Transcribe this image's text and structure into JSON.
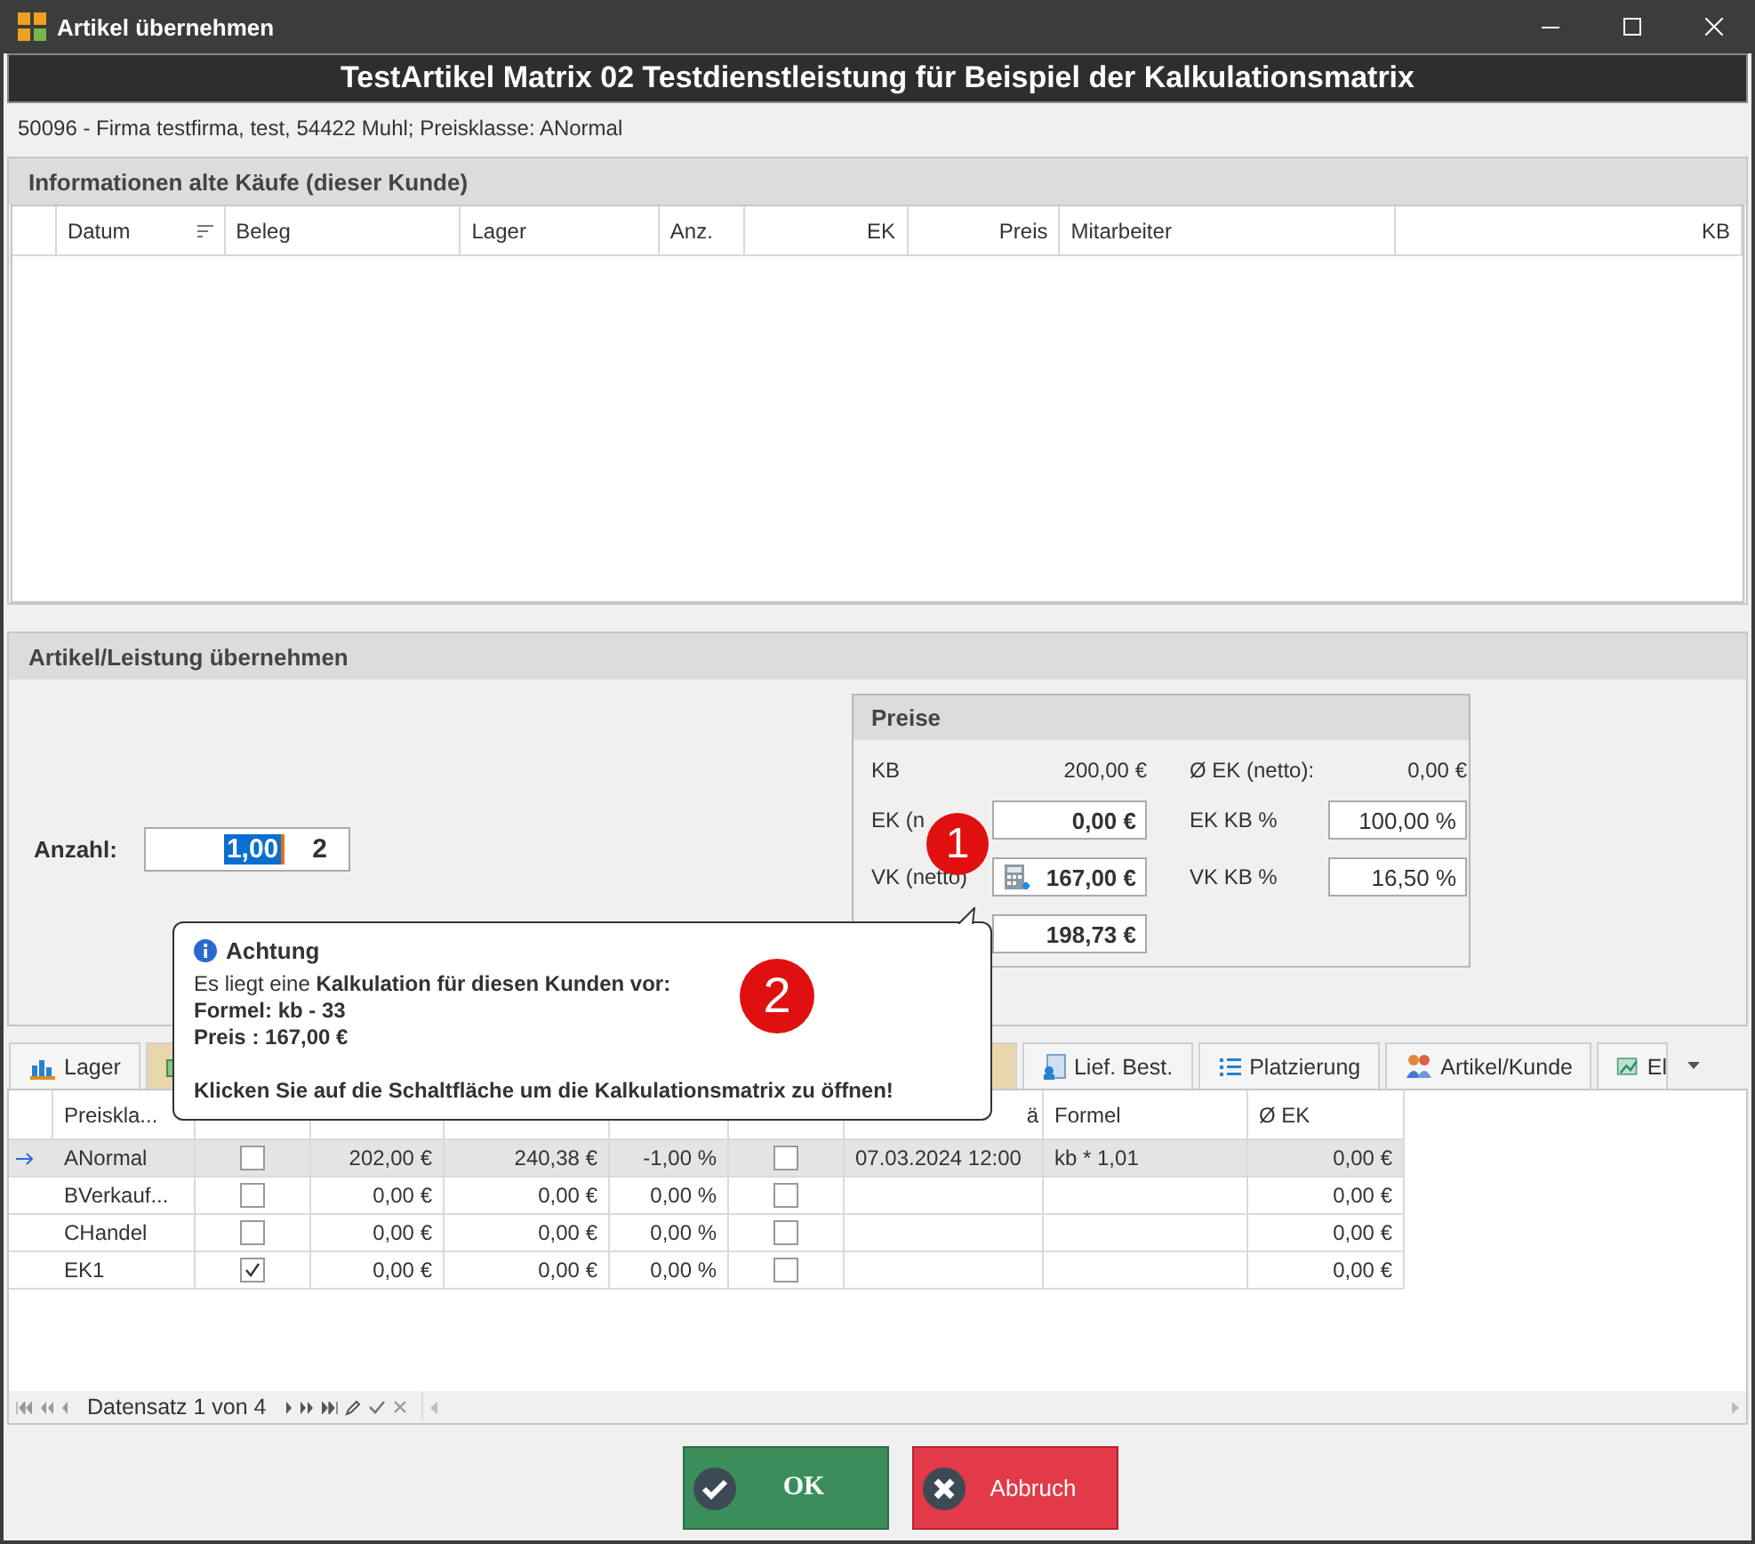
{
  "window": {
    "title": "Artikel übernehmen"
  },
  "header": {
    "title": "TestArtikel Matrix 02 Testdienstleistung für Beispiel der Kalkulationsmatrix"
  },
  "customer_line": "50096 - Firma testfirma, test, 54422 Muhl; Preisklasse: ANormal",
  "purchases": {
    "title": "Informationen alte Käufe (dieser Kunde)",
    "columns": [
      {
        "label": "Datum",
        "kind": "text",
        "sorted": true
      },
      {
        "label": "Beleg",
        "kind": "text",
        "sorted": false
      },
      {
        "label": "Lager",
        "kind": "text",
        "sorted": false
      },
      {
        "label": "Anz.",
        "kind": "text",
        "sorted": false
      },
      {
        "label": "EK",
        "kind": "number",
        "sorted": false
      },
      {
        "label": "Preis",
        "kind": "number",
        "sorted": false
      },
      {
        "label": "Mitarbeiter",
        "kind": "text",
        "sorted": false
      },
      {
        "label": "KB",
        "kind": "number",
        "sorted": false
      }
    ]
  },
  "transfer": {
    "title": "Artikel/Leistung übernehmen",
    "quantity": {
      "label": "Anzahl:",
      "value": "1,00",
      "suffix": "2"
    },
    "prices": {
      "title": "Preise",
      "kb_label": "KB",
      "kb_value": "200,00 €",
      "avg_ek_label": "Ø EK (netto):",
      "avg_ek_value": "0,00 €",
      "marker": "1",
      "left_fields": [
        {
          "label": "EK (n",
          "value": "0,00 €",
          "kind": "plain"
        },
        {
          "label": "VK (netto)",
          "value": "167,00 €",
          "kind": "calculator"
        },
        {
          "value": "198,73 €",
          "kind": "plain"
        }
      ],
      "right_fields": [
        {
          "label": "EK KB %",
          "value": "100,00 %"
        },
        {
          "label": "VK KB %",
          "value": "16,50 %"
        }
      ]
    }
  },
  "tooltip": {
    "title": "Achtung",
    "marker": "2",
    "paragraphs": [
      {
        "lines": [
          {
            "text": "Es liegt eine **Kalkulation für diesen Kunden vor:**",
            "bold": false
          },
          {
            "text": "Formel: kb - 33",
            "bold": true
          },
          {
            "text": "Preis : 167,00 €",
            "bold": true
          }
        ]
      },
      {
        "lines": [
          {
            "text": "Klicken Sie auf die Schaltfläche um die Kalkulationsmatrix zu öffnen!",
            "bold": true
          }
        ]
      }
    ]
  },
  "tabs": [
    {
      "label": "Lager",
      "selected": false
    },
    {
      "selected": true
    },
    {
      "label": "Lief. Best.",
      "selected": false
    },
    {
      "label": "Platzierung",
      "selected": false
    },
    {
      "label": "Artikel/Kunde",
      "selected": false
    },
    {
      "label": "El",
      "selected": false
    }
  ],
  "price_grid": {
    "columns": [
      {
        "label": "Preiskla...",
        "kind": "text"
      },
      {
        "kind": "check"
      },
      {
        "kind": "number"
      },
      {
        "kind": "number"
      },
      {
        "kind": "number"
      },
      {
        "kind": "check"
      },
      {
        "label": "ä",
        "kind": "date"
      },
      {
        "label": "Formel",
        "kind": "text"
      },
      {
        "label": "Ø EK",
        "kind": "number"
      }
    ],
    "rows": [
      {
        "selected": true,
        "cells": [
          "ANormal",
          false,
          "202,00 €",
          "240,38 €",
          "-1,00 %",
          false,
          "07.03.2024 12:00",
          "kb * 1,01",
          "0,00 €"
        ]
      },
      {
        "selected": false,
        "cells": [
          "BVerkauf...",
          false,
          "0,00 €",
          "0,00 €",
          "0,00 %",
          false,
          "",
          "",
          "0,00 €"
        ]
      },
      {
        "selected": false,
        "cells": [
          "CHandel",
          false,
          "0,00 €",
          "0,00 €",
          "0,00 %",
          false,
          "",
          "",
          "0,00 €"
        ]
      },
      {
        "selected": false,
        "cells": [
          "EK1",
          true,
          "0,00 €",
          "0,00 €",
          "0,00 %",
          false,
          "",
          "",
          "0,00 €"
        ]
      }
    ]
  },
  "navigator": {
    "text": "Datensatz 1 von 4"
  },
  "buttons": [
    {
      "label": "OK",
      "kind": "ok"
    },
    {
      "label": "Abbruch",
      "kind": "cancel"
    }
  ]
}
